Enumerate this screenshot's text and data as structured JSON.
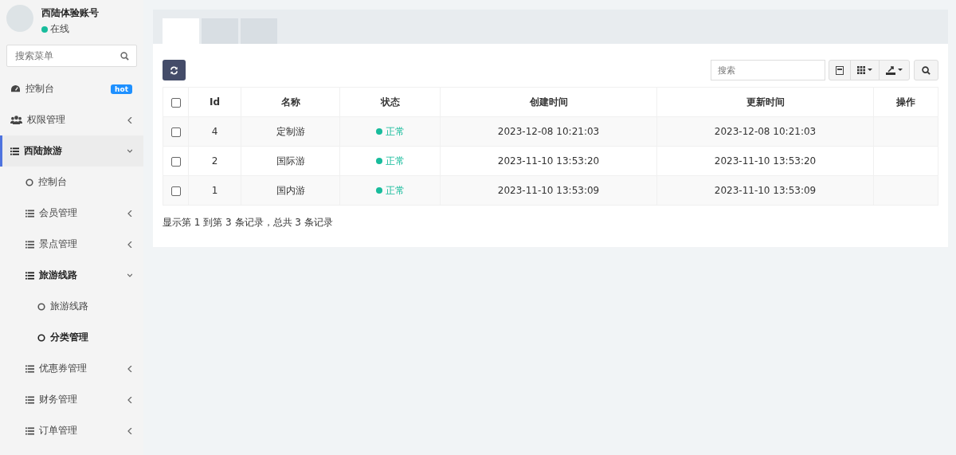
{
  "user": {
    "name": "西陆体验账号",
    "status": "在线"
  },
  "menu_search": {
    "placeholder": "搜索菜单"
  },
  "menu": [
    {
      "label": "控制台",
      "kind": "dashboard",
      "badge": "hot",
      "selected": false
    },
    {
      "label": "权限管理",
      "kind": "users",
      "expanded": false,
      "selected": false
    },
    {
      "label": "西陆旅游",
      "kind": "list",
      "expanded": true,
      "selected": true,
      "children": [
        {
          "label": "控制台",
          "kind": "circle",
          "selected": false
        },
        {
          "label": "会员管理",
          "kind": "list",
          "expanded": false,
          "selected": false
        },
        {
          "label": "景点管理",
          "kind": "list",
          "expanded": false,
          "selected": false
        },
        {
          "label": "旅游线路",
          "kind": "list",
          "expanded": true,
          "selected": true,
          "children": [
            {
              "label": "旅游线路",
              "kind": "circle",
              "selected": false
            },
            {
              "label": "分类管理",
              "kind": "circle",
              "selected": true
            }
          ]
        },
        {
          "label": "优惠券管理",
          "kind": "list",
          "expanded": false,
          "selected": false
        },
        {
          "label": "财务管理",
          "kind": "list",
          "expanded": false,
          "selected": false
        },
        {
          "label": "订单管理",
          "kind": "list",
          "expanded": false,
          "selected": false
        }
      ]
    }
  ],
  "tabs": [
    {
      "selected": true
    },
    {
      "selected": false
    },
    {
      "selected": false
    }
  ],
  "table_search": {
    "placeholder": "搜索"
  },
  "table": {
    "select_all_checked": false,
    "columns": [
      "Id",
      "名称",
      "状态",
      "创建时间",
      "更新时间",
      "操作"
    ],
    "rows": [
      {
        "checked": false,
        "id": "4",
        "name": "定制游",
        "status": "正常",
        "created": "2023-12-08 10:21:03",
        "updated": "2023-12-08 10:21:03"
      },
      {
        "checked": false,
        "id": "2",
        "name": "国际游",
        "status": "正常",
        "created": "2023-11-10 13:53:20",
        "updated": "2023-11-10 13:53:20"
      },
      {
        "checked": false,
        "id": "1",
        "name": "国内游",
        "status": "正常",
        "created": "2023-11-10 13:53:09",
        "updated": "2023-11-10 13:53:09"
      }
    ]
  },
  "pagination_info": "显示第 1 到第 3 条记录，总共 3 条记录"
}
